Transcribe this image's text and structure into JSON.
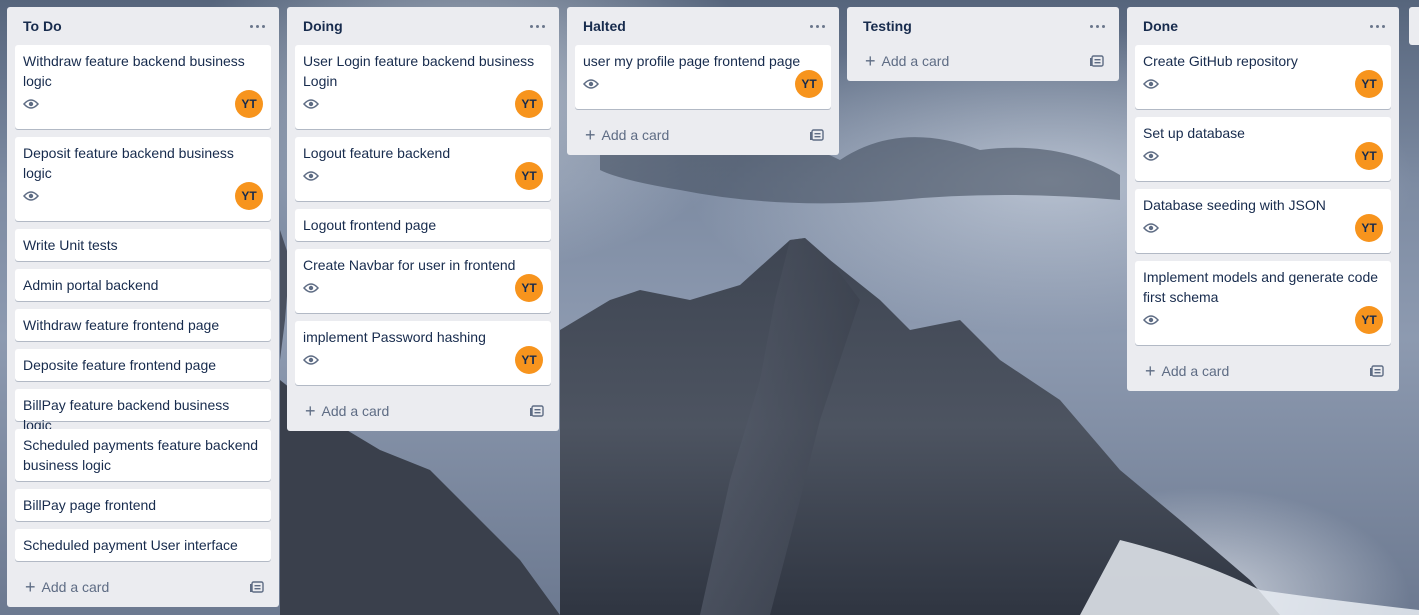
{
  "colors": {
    "avatar": "#f7941d",
    "list_bg": "#ebecf0",
    "card_bg": "#ffffff",
    "text": "#172b4d"
  },
  "icons": {
    "more": "ellipsis-icon",
    "watch": "eye-icon",
    "add": "plus-icon",
    "template": "template-icon"
  },
  "lists": [
    {
      "title": "To Do",
      "add_label": "Add a card",
      "cards": [
        {
          "title": "Withdraw feature backend business logic",
          "watching": true,
          "member": "YT"
        },
        {
          "title": "Deposit feature backend business logic",
          "watching": true,
          "member": "YT"
        },
        {
          "title": "Write Unit tests"
        },
        {
          "title": "Admin portal backend"
        },
        {
          "title": "Withdraw feature frontend page"
        },
        {
          "title": "Deposite feature frontend page"
        },
        {
          "title": "BillPay feature backend business logic"
        },
        {
          "title": "Scheduled payments feature backend business logic"
        },
        {
          "title": "BillPay page frontend"
        },
        {
          "title": "Scheduled payment User interface"
        }
      ]
    },
    {
      "title": "Doing",
      "add_label": "Add a card",
      "cards": [
        {
          "title": "User Login feature backend business Login",
          "watching": true,
          "member": "YT"
        },
        {
          "title": "Logout feature backend",
          "watching": true,
          "member": "YT"
        },
        {
          "title": "Logout frontend page"
        },
        {
          "title": "Create Navbar for user in frontend",
          "watching": true,
          "member": "YT"
        },
        {
          "title": "implement Password hashing",
          "watching": true,
          "member": "YT"
        }
      ]
    },
    {
      "title": "Halted",
      "add_label": "Add a card",
      "cards": [
        {
          "title": "user my profile page frontend page",
          "watching": true,
          "member": "YT"
        }
      ]
    },
    {
      "title": "Testing",
      "add_label": "Add a card",
      "cards": []
    },
    {
      "title": "Done",
      "add_label": "Add a card",
      "cards": [
        {
          "title": "Create GitHub repository",
          "watching": true,
          "member": "YT"
        },
        {
          "title": "Set up database",
          "watching": true,
          "member": "YT"
        },
        {
          "title": "Database seeding with JSON",
          "watching": true,
          "member": "YT"
        },
        {
          "title": "Implement models and generate code first schema",
          "watching": true,
          "member": "YT"
        }
      ]
    }
  ]
}
